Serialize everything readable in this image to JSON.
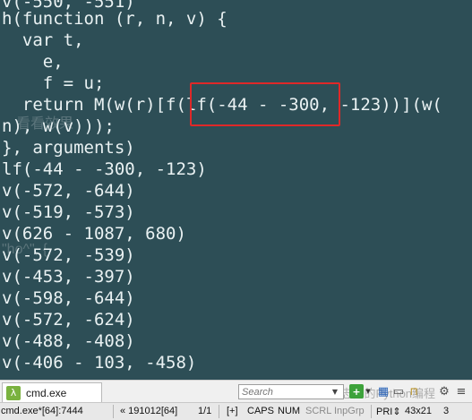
{
  "console": {
    "lines": [
      "v(-550, -551)",
      "h(function (r, n, v) {",
      "  var t,",
      "    e,",
      "    f = u;",
      "  return M(w(r)[f(lf(-44 - -300, -123))](w(",
      "n), w(v)));",
      "}, arguments)",
      "lf(-44 - -300, -123)",
      "v(-572, -644)",
      "v(-519, -573)",
      "v(626 - 1087, 680)",
      "v(-572, -539)",
      "v(-453, -397)",
      "v(-598, -644)",
      "v(-572, -624)",
      "v(-488, -408)",
      "v(-406 - 103, -458)"
    ],
    "ghost_text_1": "看看效果",
    "ghost_text_2": "\"ho^\", {"
  },
  "tabbar": {
    "tab_label": "cmd.exe",
    "tab_icon": "λ",
    "search_placeholder": "Search",
    "watermark": "公众号 · 志良的Python编程"
  },
  "status": {
    "title": "cmd.exe*[64]:7444",
    "position": "« 191012[64]",
    "pages": "1/1",
    "flags": "[+]",
    "caps": "CAPS",
    "num": "NUM",
    "scrl": "SCRL",
    "inpgrp": "InpGrp",
    "pri": "PRI⇕",
    "size": "43x21",
    "count": "3"
  },
  "colors": {
    "console_bg": "#2d4e56",
    "console_text": "#e9f1f2",
    "highlight": "#e02828"
  }
}
